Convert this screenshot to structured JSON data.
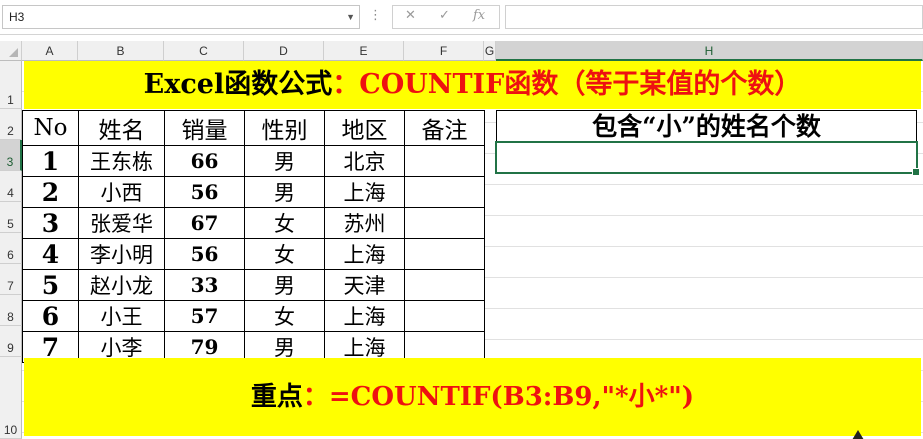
{
  "formula_bar": {
    "name_box": "H3",
    "cancel_glyph": "✕",
    "enter_glyph": "✓",
    "fx_glyph": "fx",
    "formula": ""
  },
  "columns": [
    "A",
    "B",
    "C",
    "D",
    "E",
    "F",
    "G",
    "H"
  ],
  "rows": [
    "1",
    "2",
    "3",
    "4",
    "5",
    "6",
    "7",
    "8",
    "9",
    "10"
  ],
  "selected_cell": "H3",
  "title": {
    "part1": "Excel函数公式",
    "part2": "：COUNTIF函数（等于某值的个数）"
  },
  "table": {
    "headers": [
      "No",
      "姓名",
      "销量",
      "性别",
      "地区",
      "备注"
    ],
    "rows": [
      {
        "no": "1",
        "name": "王东栋",
        "sales": "66",
        "gender": "男",
        "region": "北京",
        "note": ""
      },
      {
        "no": "2",
        "name": "小西",
        "sales": "56",
        "gender": "男",
        "region": "上海",
        "note": ""
      },
      {
        "no": "3",
        "name": "张爱华",
        "sales": "67",
        "gender": "女",
        "region": "苏州",
        "note": ""
      },
      {
        "no": "4",
        "name": "李小明",
        "sales": "56",
        "gender": "女",
        "region": "上海",
        "note": ""
      },
      {
        "no": "5",
        "name": "赵小龙",
        "sales": "33",
        "gender": "男",
        "region": "天津",
        "note": ""
      },
      {
        "no": "6",
        "name": "小王",
        "sales": "57",
        "gender": "女",
        "region": "上海",
        "note": ""
      },
      {
        "no": "7",
        "name": "小李",
        "sales": "79",
        "gender": "男",
        "region": "上海",
        "note": ""
      }
    ]
  },
  "result": {
    "title": "包含“小”的姓名个数",
    "value": ""
  },
  "bottom_note": {
    "label": "重点",
    "formula": "：=COUNTIF(B3:B9,\"*小*\")"
  },
  "colors": {
    "highlight": "#ffff00",
    "accent_red": "#ee1111",
    "selection_green": "#217346"
  }
}
